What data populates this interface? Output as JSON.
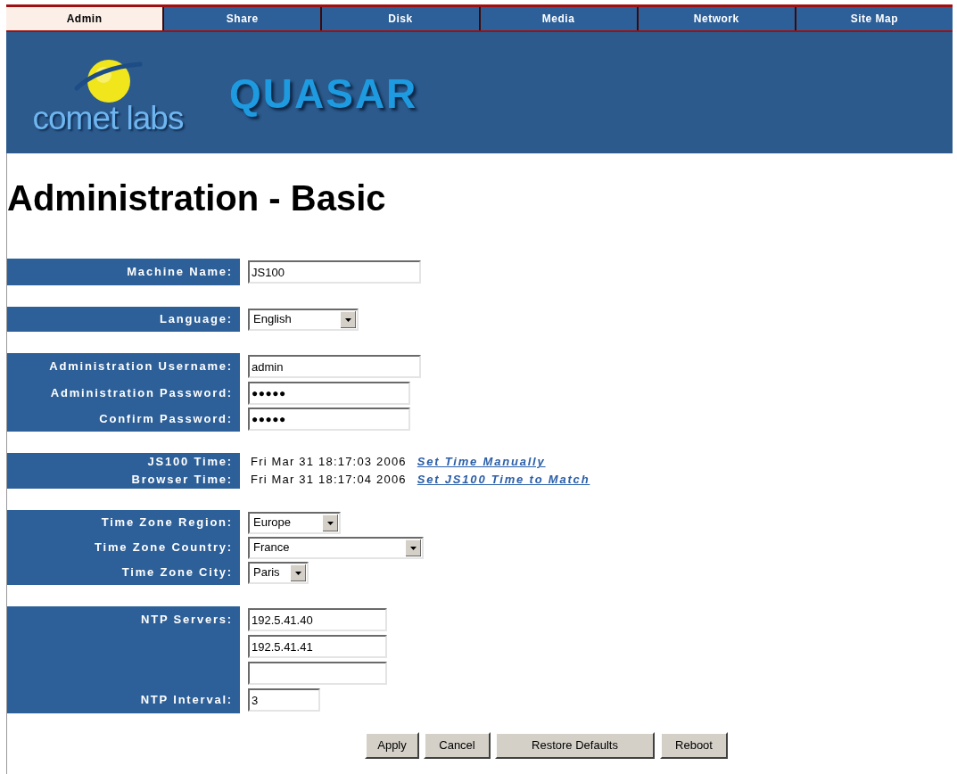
{
  "nav": {
    "tabs": [
      {
        "label": "Admin",
        "selected": true
      },
      {
        "label": "Share",
        "selected": false
      },
      {
        "label": "Disk",
        "selected": false
      },
      {
        "label": "Media",
        "selected": false
      },
      {
        "label": "Network",
        "selected": false
      },
      {
        "label": "Site Map",
        "selected": false
      }
    ]
  },
  "banner": {
    "company_logo": "comet labs",
    "product_logo": "QUASAR"
  },
  "page_title": "Administration - Basic",
  "sections": [
    {
      "rows": [
        {
          "kind": "text",
          "label": "Machine Name:",
          "value": "JS100"
        }
      ]
    },
    {
      "rows": [
        {
          "kind": "select",
          "label": "Language:",
          "value": "English"
        }
      ]
    },
    {
      "rows": [
        {
          "kind": "text",
          "label": "Administration Username:",
          "value": "admin"
        },
        {
          "kind": "password",
          "label": "Administration Password:",
          "value": "●●●●●"
        },
        {
          "kind": "password",
          "label": "Confirm Password:",
          "value": "●●●●●"
        }
      ]
    },
    {
      "rows": [
        {
          "kind": "time",
          "label": "JS100 Time:",
          "value": "Fri Mar 31 18:17:03 2006",
          "link": "Set Time Manually"
        },
        {
          "kind": "time",
          "label": "Browser Time:",
          "value": "Fri Mar 31 18:17:04 2006",
          "link": "Set JS100 Time to Match"
        }
      ]
    },
    {
      "rows": [
        {
          "kind": "select",
          "label": "Time Zone Region:",
          "value": "Europe"
        },
        {
          "kind": "select",
          "label": "Time Zone Country:",
          "value": "France"
        },
        {
          "kind": "select",
          "label": "Time Zone City:",
          "value": "Paris"
        }
      ]
    },
    {
      "rows": [
        {
          "kind": "text",
          "label": "NTP Servers:",
          "value": "192.5.41.40"
        },
        {
          "kind": "text",
          "value": "192.5.41.41"
        },
        {
          "kind": "text"
        },
        {
          "kind": "text",
          "label": "NTP Interval:",
          "value": "3"
        }
      ]
    }
  ],
  "buttons": [
    "Apply",
    "Cancel",
    "Restore Defaults",
    "Reboot"
  ]
}
